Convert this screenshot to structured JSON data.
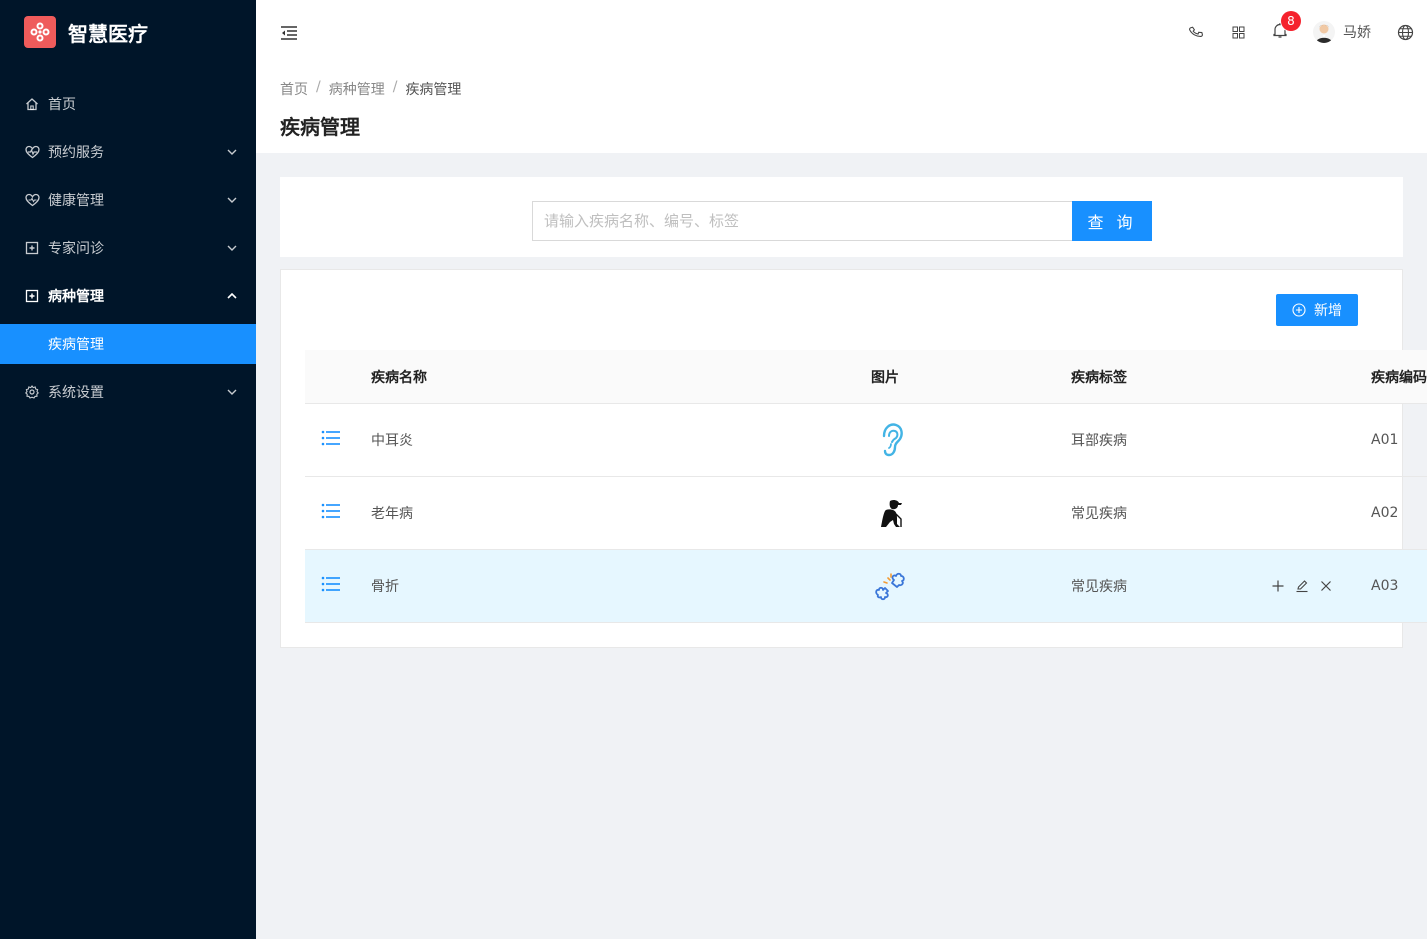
{
  "app": {
    "title": "智慧医疗"
  },
  "sidebar": {
    "items": [
      {
        "label": "首页",
        "icon": "home-icon"
      },
      {
        "label": "预约服务",
        "icon": "heart-pulse-icon"
      },
      {
        "label": "健康管理",
        "icon": "heart-icon"
      },
      {
        "label": "专家问诊",
        "icon": "medical-box-icon"
      },
      {
        "label": "病种管理",
        "icon": "medical-box-icon"
      },
      {
        "label": "疾病管理"
      },
      {
        "label": "系统设置",
        "icon": "gear-icon"
      }
    ]
  },
  "header": {
    "notification_count": "8",
    "user_name": "马娇"
  },
  "breadcrumb": [
    "首页",
    "病种管理",
    "疾病管理"
  ],
  "page_title": "疾病管理",
  "search": {
    "placeholder": "请输入疾病名称、编号、标签",
    "button_label": "查 询"
  },
  "table": {
    "add_label": "新增",
    "columns": [
      "疾病名称",
      "图片",
      "疾病标签",
      "疾病编码"
    ],
    "rows": [
      {
        "name": "中耳炎",
        "image": "ear-icon",
        "tag": "耳部疾病",
        "code": "A01"
      },
      {
        "name": "老年病",
        "image": "elderly-person-icon",
        "tag": "常见疾病",
        "code": "A02"
      },
      {
        "name": "骨折",
        "image": "broken-bone-icon",
        "tag": "常见疾病",
        "code": "A03"
      }
    ]
  },
  "colors": {
    "primary": "#1890ff",
    "sidebar_bg": "#001529",
    "badge": "#f5222d",
    "logo": "#ef5b5b"
  }
}
